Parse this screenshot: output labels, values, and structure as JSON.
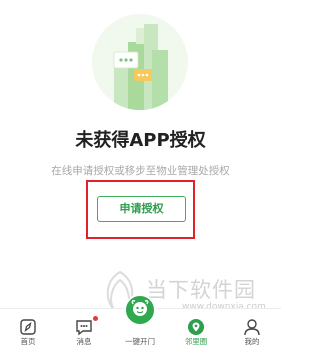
{
  "main": {
    "title": "未获得APP授权",
    "description": "在线申请授权或移步至物业管理处授权",
    "apply_button": "申请授权"
  },
  "watermark": {
    "text": "当下软件园",
    "url": "www.downxia.com"
  },
  "tabbar": {
    "tabs": [
      {
        "label": "首页",
        "icon": "compass-icon"
      },
      {
        "label": "消息",
        "icon": "message-icon"
      },
      {
        "label": "一键开门",
        "icon": "door-open-icon"
      },
      {
        "label": "邻里圈",
        "icon": "location-icon"
      },
      {
        "label": "我的",
        "icon": "user-icon"
      }
    ],
    "active_index": 3
  },
  "colors": {
    "accent": "#2e9e4f",
    "highlight_border": "#e0232b",
    "badge": "#e63b2e"
  }
}
